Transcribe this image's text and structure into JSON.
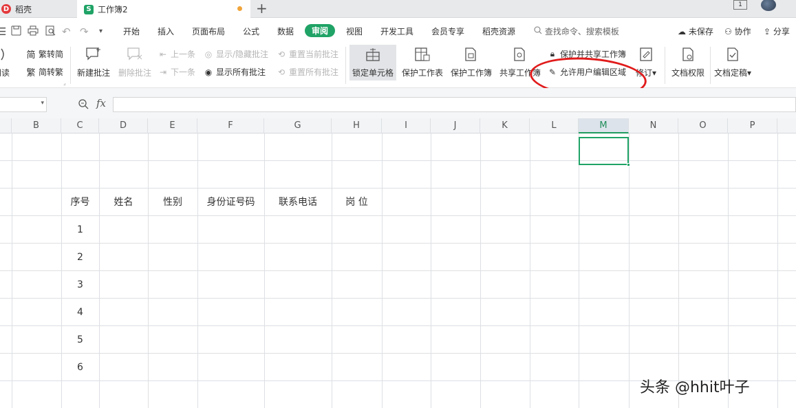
{
  "tabs": {
    "docer_label": "稻壳",
    "book_label": "工作簿2",
    "new_tab": "+"
  },
  "window": {
    "tile_label": "1"
  },
  "menu": {
    "items": [
      "开始",
      "插入",
      "页面布局",
      "公式",
      "数据",
      "审阅",
      "视图",
      "开发工具",
      "会员专享",
      "稻壳资源"
    ],
    "active": "审阅",
    "search_placeholder": "查找命令、搜索模板",
    "unsaved": "未保存",
    "collaborate": "协作",
    "share": "分享"
  },
  "ribbon": {
    "read_aloud": "朗读",
    "trad_to_simp": "繁转简",
    "simp_to_trad": "简转繁",
    "new_comment": "新建批注",
    "delete_comment": "删除批注",
    "prev_item": "上一条",
    "next_item": "下一条",
    "show_hide_comment": "显示/隐藏批注",
    "show_all_comments": "显示所有批注",
    "reset_current_comment": "重置当前批注",
    "reset_all_comments": "重置所有批注",
    "lock_cell": "锁定单元格",
    "protect_sheet": "保护工作表",
    "protect_book": "保护工作簿",
    "share_book": "共享工作簿",
    "protect_share_book": "保护并共享工作簿",
    "allow_edit_ranges": "允许用户编辑区域",
    "revisions": "修订",
    "doc_permissions": "文档权限",
    "doc_finalize": "文档定稿"
  },
  "formula": {
    "fx": "fx",
    "value": ""
  },
  "sheet": {
    "columns": [
      "B",
      "C",
      "D",
      "E",
      "F",
      "G",
      "H",
      "I",
      "J",
      "K",
      "L",
      "M",
      "N",
      "O",
      "P"
    ],
    "selected_column": "M",
    "headers": [
      "序号",
      "姓名",
      "性别",
      "身份证号码",
      "联系电话",
      "岗 位"
    ],
    "row_numbers": [
      "1",
      "2",
      "3",
      "4",
      "5",
      "6"
    ]
  },
  "watermark": "头条 @hhit叶子",
  "colors": {
    "accent": "#20a366",
    "annotation": "#e11b1b",
    "docer_red": "#e4393c"
  }
}
